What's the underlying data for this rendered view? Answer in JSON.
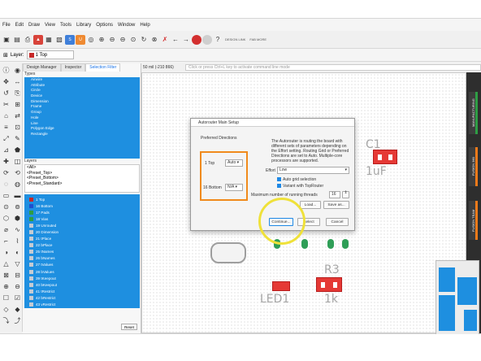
{
  "menubar": [
    "File",
    "Edit",
    "Draw",
    "View",
    "Tools",
    "Library",
    "Options",
    "Window",
    "Help"
  ],
  "toolbar": {
    "layer_label": "Layer:",
    "layer_value": "1 Top",
    "toolbar_small_labels": [
      "DESIGN LINK",
      "FAB MORE"
    ],
    "icons": [
      "open-icon",
      "save-icon",
      "print-icon",
      "cam-icon",
      "board-icon",
      "schematic-icon",
      "scr-icon",
      "ulp-icon",
      "zoom-fit-icon",
      "zoom-in-icon",
      "zoom-out-icon",
      "zoom-out2-icon",
      "zoom-select-icon",
      "undo-icon",
      "redo-icon",
      "cancel-icon",
      "go-icon",
      "stop-icon",
      "help-icon"
    ]
  },
  "panel": {
    "tabs": [
      "Design Manager",
      "Inspector",
      "Selection Filter"
    ],
    "active_tab": "Selection Filter",
    "types_header": "Types",
    "types": [
      "Airwire",
      "Attribute",
      "Circle",
      "Device",
      "Dimension",
      "Frame",
      "Group",
      "Hole",
      "Line",
      "Polygon Edge",
      "Rectangle"
    ],
    "layers_header": "Layers",
    "layer_presets": [
      "<All>",
      "<Preset_Top>",
      "<Preset_Bottom>",
      "<Preset_Standard>"
    ],
    "layers": [
      "1 Top",
      "16 Bottom",
      "17 Pads",
      "18 Vias",
      "19 Unrouted",
      "20 Dimension",
      "21 tPlace",
      "22 bPlace",
      "25 tNames",
      "26 bNames",
      "27 tValues",
      "28 bValues",
      "39 tKeepout",
      "40 bKeepout",
      "41 tRestrict",
      "42 bRestrict",
      "43 vRestrict"
    ],
    "reset_label": "Reset"
  },
  "coordbar": {
    "coords": "50 mil (-210 866)",
    "command_placeholder": "Click or press Ctrl+L key to activate command line mode"
  },
  "canvas": {
    "c1_label": "C1",
    "c1_value": "1uF",
    "r3_label": "R3",
    "r3_value": "1k",
    "led_label": "LED1"
  },
  "right_tabs": [
    "MANUFACTURING",
    "FUSION 360",
    "FUSION TEAM"
  ],
  "right_tab_colors": [
    "#2e9d44",
    "#f07a1a",
    "#f07a1a"
  ],
  "dialog": {
    "title": "Autorouter Main Setup",
    "preferred_directions_label": "Preferred Directions",
    "dir1_layer": "1 Top",
    "dir1_value": "Auto",
    "dir2_layer": "16 Bottom",
    "dir2_value": "N/A",
    "description": "The Autorouter is routing the board with different sets of parameters depending on the Effort setting. Routing Grid or Preferred Directions are set to Auto. Multiple-core processors are supported.",
    "effort_label": "Effort",
    "effort_value": "Low",
    "auto_grid_label": "Auto grid selection",
    "variant_label": "Variant with TopRouter",
    "threads_label": "Maximum number of running threads",
    "threads_value": "16",
    "load_label": "Load...",
    "save_as_label": "Save as...",
    "continue_label": "Continue...",
    "select_label": "Select",
    "cancel_label": "Cancel"
  },
  "highlight_colors": {
    "orange": "#f08a1c",
    "yellow": "#efe13a"
  }
}
